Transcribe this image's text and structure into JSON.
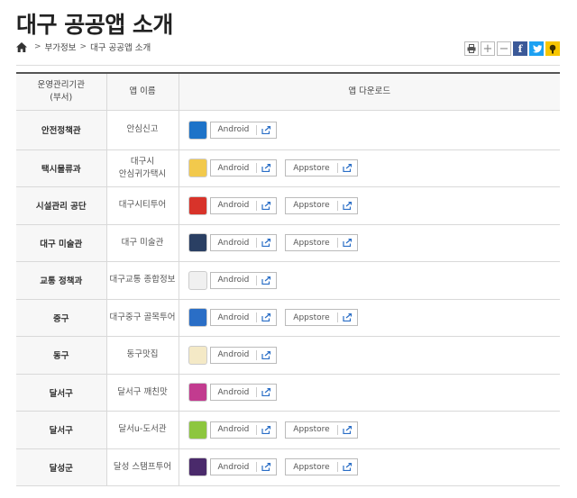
{
  "page": {
    "title": "대구 공공앱 소개"
  },
  "breadcrumb": {
    "items": [
      "부가정보",
      "대구 공공앱 소개"
    ],
    "separator": ">"
  },
  "tools": {
    "plus": "+",
    "minus": "−",
    "facebook": "f"
  },
  "table": {
    "headers": {
      "agency": "운영관리기관\n(부서)",
      "app": "앱 이름",
      "download": "앱 다운로드"
    },
    "android_label": "Android",
    "appstore_label": "Appstore",
    "rows": [
      {
        "agency": "안전정책관",
        "app": "안심신고",
        "icon": "safety-report-icon",
        "color": "#1e73c8",
        "appstore": false
      },
      {
        "agency": "택시물류과",
        "app": "대구시\n안심귀가택시",
        "icon": "taxi-icon",
        "color": "#f2c94c",
        "appstore": true
      },
      {
        "agency": "시설관리 공단",
        "app": "대구시티투어",
        "icon": "city-tour-icon",
        "color": "#d8332a",
        "appstore": true
      },
      {
        "agency": "대구 미술관",
        "app": "대구 미술관",
        "icon": "art-museum-icon",
        "color": "#2a3f63",
        "appstore": true
      },
      {
        "agency": "교통 정책과",
        "app": "대구교통 종합정보",
        "icon": "traffic-info-icon",
        "color": "#f0f0f0",
        "appstore": false
      },
      {
        "agency": "중구",
        "app": "대구중구 골목투어",
        "icon": "alley-tour-icon",
        "color": "#2a6ec6",
        "appstore": true
      },
      {
        "agency": "동구",
        "app": "동구맛집",
        "icon": "restaurant-icon",
        "color": "#f4e9c6",
        "appstore": false
      },
      {
        "agency": "달서구",
        "app": "달서구 깨친맛",
        "icon": "dalseo-food-icon",
        "color": "#c23b8f",
        "appstore": false
      },
      {
        "agency": "달서구",
        "app": "달서u-도서관",
        "icon": "library-icon",
        "color": "#8dc63f",
        "appstore": true
      },
      {
        "agency": "달성군",
        "app": "달성 스탬프투어",
        "icon": "stamp-tour-icon",
        "color": "#4a2a6b",
        "appstore": true
      }
    ]
  }
}
